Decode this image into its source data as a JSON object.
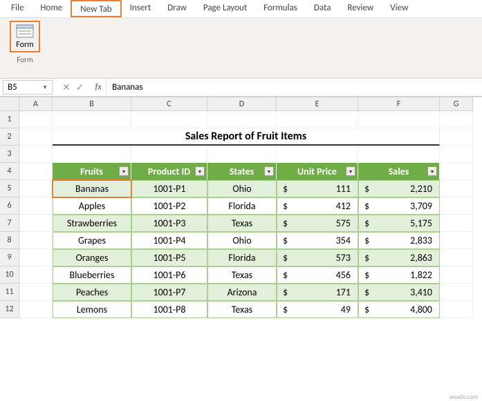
{
  "ribbon": {
    "tabs": [
      "File",
      "Home",
      "New Tab",
      "Insert",
      "Draw",
      "Page Layout",
      "Formulas",
      "Data",
      "Review",
      "View"
    ],
    "active_index": 2,
    "form_button": "Form",
    "group_label": "Form"
  },
  "namebox": "B5",
  "fx_label": "fx",
  "formula_value": "Bananas",
  "columns": [
    "A",
    "B",
    "C",
    "D",
    "E",
    "F",
    "G"
  ],
  "rows": [
    "1",
    "2",
    "3",
    "4",
    "5",
    "6",
    "7",
    "8",
    "9",
    "10",
    "11",
    "12"
  ],
  "title": "Sales Report of Fruit Items",
  "headers": [
    "Fruits",
    "Product ID",
    "States",
    "Unit Price",
    "Sales"
  ],
  "currency": "$",
  "data": [
    {
      "fruit": "Bananas",
      "id": "1001-P1",
      "state": "Ohio",
      "price": "111",
      "sales": "2,210"
    },
    {
      "fruit": "Apples",
      "id": "1001-P2",
      "state": "Florida",
      "price": "412",
      "sales": "3,709"
    },
    {
      "fruit": "Strawberries",
      "id": "1001-P3",
      "state": "Texas",
      "price": "575",
      "sales": "5,175"
    },
    {
      "fruit": "Grapes",
      "id": "1001-P4",
      "state": "Ohio",
      "price": "354",
      "sales": "2,833"
    },
    {
      "fruit": "Oranges",
      "id": "1001-P5",
      "state": "Florida",
      "price": "573",
      "sales": "2,863"
    },
    {
      "fruit": "Blueberries",
      "id": "1001-P6",
      "state": "Texas",
      "price": "456",
      "sales": "1,822"
    },
    {
      "fruit": "Peaches",
      "id": "1001-P7",
      "state": "Arizona",
      "price": "171",
      "sales": "3,410"
    },
    {
      "fruit": "Lemons",
      "id": "1001-P8",
      "state": "Texas",
      "price": "49",
      "sales": "4,800"
    }
  ],
  "watermark": "wsxdn.com",
  "chart_data": {
    "type": "table",
    "title": "Sales Report of Fruit Items",
    "columns": [
      "Fruits",
      "Product ID",
      "States",
      "Unit Price",
      "Sales"
    ],
    "rows": [
      [
        "Bananas",
        "1001-P1",
        "Ohio",
        111,
        2210
      ],
      [
        "Apples",
        "1001-P2",
        "Florida",
        412,
        3709
      ],
      [
        "Strawberries",
        "1001-P3",
        "Texas",
        575,
        5175
      ],
      [
        "Grapes",
        "1001-P4",
        "Ohio",
        354,
        2833
      ],
      [
        "Oranges",
        "1001-P5",
        "Florida",
        573,
        2863
      ],
      [
        "Blueberries",
        "1001-P6",
        "Texas",
        456,
        1822
      ],
      [
        "Peaches",
        "1001-P7",
        "Arizona",
        171,
        3410
      ],
      [
        "Lemons",
        "1001-P8",
        "Texas",
        49,
        4800
      ]
    ]
  }
}
